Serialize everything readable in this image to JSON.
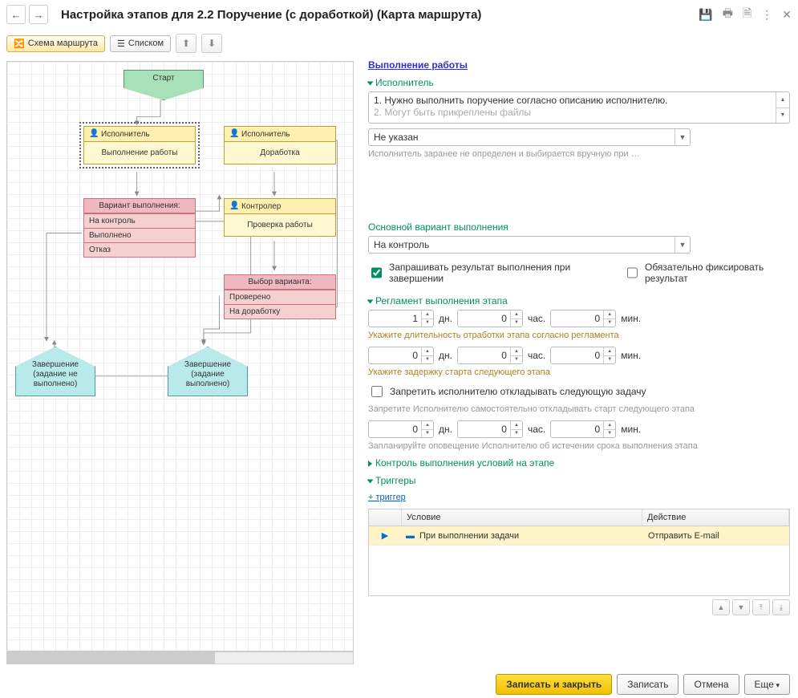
{
  "header": {
    "title": "Настройка этапов для 2.2 Поручение  (с доработкой) (Карта маршрута)"
  },
  "toolbar": {
    "scheme": "Схема маршрута",
    "list": "Списком"
  },
  "diagram": {
    "start": "Старт",
    "exec1_h": "Исполнитель",
    "exec1_b": "Выполнение работы",
    "exec2_h": "Исполнитель",
    "exec2_b": "Доработка",
    "ctrl_h": "Контролер",
    "ctrl_b": "Проверка работы",
    "cond1_h": "Вариант выполнения:",
    "cond1_o1": "На контроль",
    "cond1_o2": "Выполнено",
    "cond1_o3": "Отказ",
    "cond2_h": "Выбор варианта:",
    "cond2_o1": "Проверено",
    "cond2_o2": "На доработку",
    "end1": "Завершение (задание не выполнено)",
    "end2": "Завершение (задание выполнено)"
  },
  "panel": {
    "worktitle": "Выполнение работы",
    "grp_exec": "Исполнитель",
    "desc_l1": "1. Нужно выполнить поручение согласно описанию исполнителю.",
    "desc_l2": "2. Могут быть прикреплены файлы",
    "exec_val": "Не указан",
    "exec_hint": "Исполнитель заранее не определен и выбирается вручную при …",
    "lbl_variant": "Основной вариант выполнения",
    "variant_val": "На контроль",
    "chk_ask": "Запрашивать результат выполнения при завершении",
    "chk_fix": "Обязательно фиксировать результат",
    "grp_reg": "Регламент выполнения этапа",
    "u_day": "дн.",
    "u_hour": "час.",
    "u_min": "мин.",
    "reg_hint1": "Укажите длительность отработки этапа согласно регламента",
    "reg_hint2": "Укажите задержку старта следующего этапа",
    "chk_deny": "Запретить исполнителю откладывать следующую задачу",
    "deny_hint": "Запретите Исполнителю самостоятельно откладывать старт следующего этапа",
    "plan_hint": "Запланируйте оповещение Исполнителю об истечении срока выполнения этапа",
    "grp_ctrl": "Контроль выполнения условий на этапе",
    "grp_trig": "Триггеры",
    "add_trig": "+ триггер",
    "th_cond": "Условие",
    "th_act": "Действие",
    "tr_cond": "При выполнении задачи",
    "tr_act": "Отправить E-mail",
    "v1_d": "1",
    "v1_h": "0",
    "v1_m": "0",
    "v2_d": "0",
    "v2_h": "0",
    "v2_m": "0",
    "v3_d": "0",
    "v3_h": "0",
    "v3_m": "0"
  },
  "footer": {
    "save_close": "Записать и закрыть",
    "save": "Записать",
    "cancel": "Отмена",
    "more": "Еще"
  }
}
